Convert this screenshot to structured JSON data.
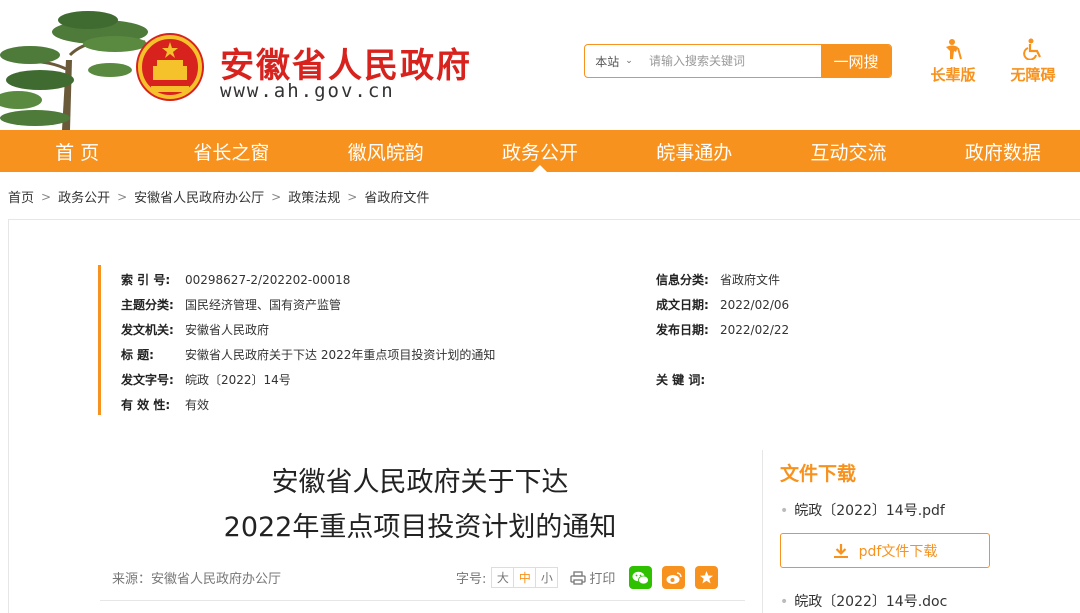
{
  "header": {
    "site_title": "安徽省人民政府",
    "site_url": "www.ah.gov.cn",
    "search": {
      "scope": "本站",
      "placeholder": "请输入搜索关键词",
      "button": "一网搜"
    },
    "elder_mode": "长辈版",
    "accessibility": "无障碍"
  },
  "nav": {
    "items": [
      "首 页",
      "省长之窗",
      "徽风皖韵",
      "政务公开",
      "皖事通办",
      "互动交流",
      "政府数据"
    ],
    "active": "政务公开"
  },
  "breadcrumb": [
    "首页",
    "政务公开",
    "安徽省人民政府办公厅",
    "政策法规",
    "省政府文件"
  ],
  "meta": {
    "index_no_label": "索 引 号:",
    "index_no": "00298627-2/202202-00018",
    "topic_label": "主题分类:",
    "topic": "国民经济管理、国有资产监管",
    "issuer_label": "发文机关:",
    "issuer": "安徽省人民政府",
    "title_label": "标 题:",
    "title": "安徽省人民政府关于下达 2022年重点项目投资计划的通知",
    "doc_no_label": "发文字号:",
    "doc_no": "皖政〔2022〕14号",
    "validity_label": "有 效 性:",
    "validity": "有效",
    "info_cat_label": "信息分类:",
    "info_cat": "省政府文件",
    "created_label": "成文日期:",
    "created": "2022/02/06",
    "published_label": "发布日期:",
    "published": "2022/02/22",
    "keywords_label": "关 键 词:",
    "keywords": ""
  },
  "article": {
    "title_line1": "安徽省人民政府关于下达",
    "title_line2": "2022年重点项目投资计划的通知",
    "source": "来源：安徽省人民政府办公厅",
    "font_label": "字号:",
    "font_sizes": [
      "大",
      "中",
      "小"
    ],
    "font_active": "中",
    "print": "打印"
  },
  "downloads": {
    "title": "文件下载",
    "pdf_name": "皖政〔2022〕14号.pdf",
    "pdf_button": "pdf文件下载",
    "doc_name": "皖政〔2022〕14号.doc"
  },
  "colors": {
    "accent": "#f7921e",
    "title_red": "#d7221d",
    "wechat": "#2dc100",
    "weibo": "#f7921e",
    "favorite": "#f7921e"
  }
}
